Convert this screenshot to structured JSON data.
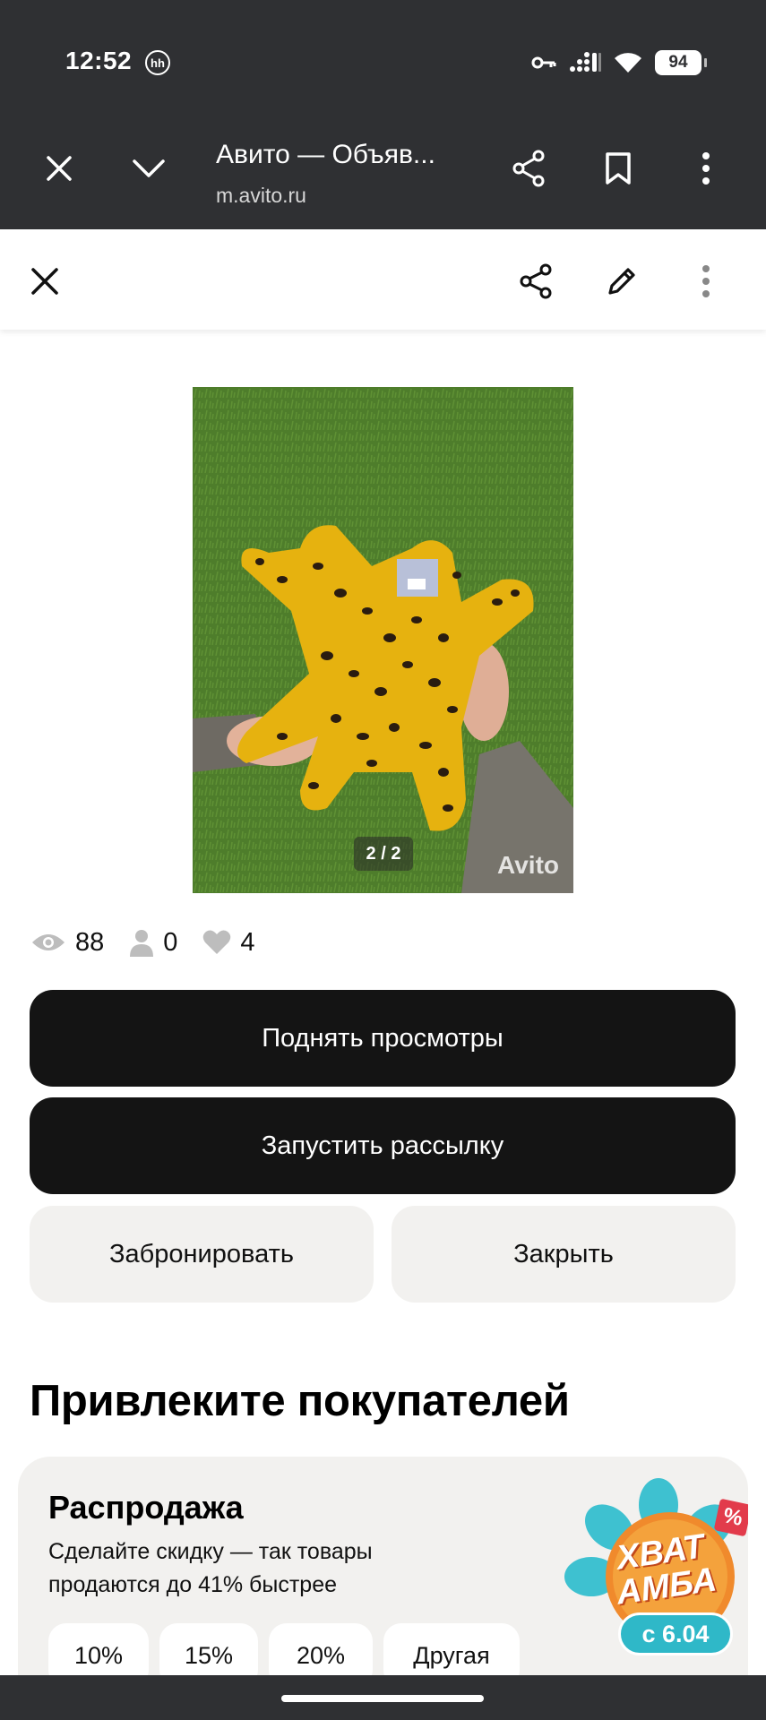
{
  "status_bar": {
    "time": "12:52",
    "badge": "hh",
    "battery": "94"
  },
  "browser": {
    "title": "Авито — Объяв...",
    "url": "m.avito.ru"
  },
  "photo": {
    "counter": "2 / 2",
    "watermark": "Avito"
  },
  "stats": {
    "views": "88",
    "contacts": "0",
    "favorites": "4"
  },
  "actions": {
    "raise_views": "Поднять просмотры",
    "start_mailing": "Запустить рассылку",
    "reserve": "Забронировать",
    "close": "Закрыть"
  },
  "promo_section": {
    "title": "Привлеките покупателей",
    "card": {
      "title": "Распродажа",
      "description": "Сделайте скидку — так товары продаются до 41% быстрее",
      "chips": [
        "10%",
        "15%",
        "20%",
        "Другая"
      ],
      "badge_line1": "ХВАТ",
      "badge_line2": "АМБА",
      "badge_date": "с 6.04",
      "badge_pct": "%"
    }
  },
  "colors": {
    "chrome": "#2f3033",
    "dark_button": "#141414",
    "light_button": "#f2f1ef",
    "badge_teal": "#2fb8c8",
    "badge_orange": "#f08a2c"
  }
}
